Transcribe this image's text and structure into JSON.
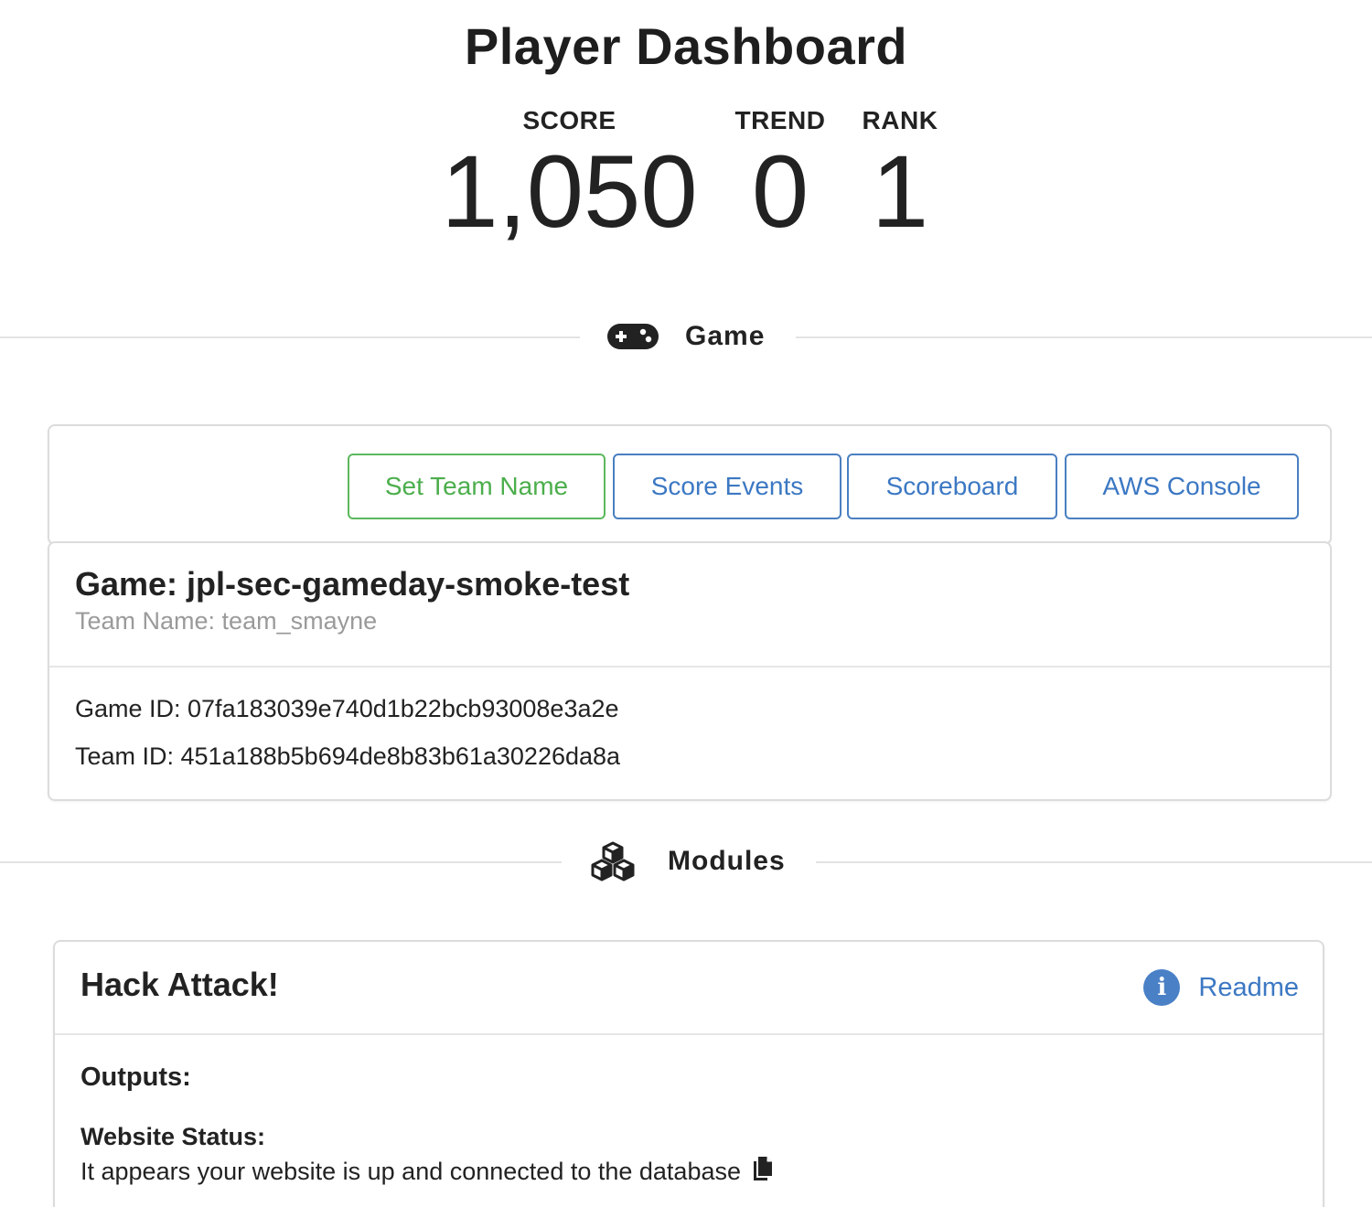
{
  "header": {
    "title": "Player Dashboard",
    "stats": {
      "score": {
        "label": "SCORE",
        "value": "1,050"
      },
      "trend": {
        "label": "TREND",
        "value": "0"
      },
      "rank": {
        "label": "RANK",
        "value": "1"
      }
    }
  },
  "sections": {
    "game": {
      "heading": "Game",
      "icon": "gamepad-icon"
    },
    "modules": {
      "heading": "Modules",
      "icon": "cubes-icon"
    }
  },
  "toolbar": {
    "set_team_name": "Set Team Name",
    "score_events": "Score Events",
    "scoreboard": "Scoreboard",
    "aws_console": "AWS Console"
  },
  "game": {
    "title": "Game: jpl-sec-gameday-smoke-test",
    "team_name": "Team Name: team_smayne",
    "game_id": "Game ID: 07fa183039e740d1b22bcb93008e3a2e",
    "team_id": "Team ID: 451a188b5b694de8b83b61a30226da8a"
  },
  "module": {
    "title": "Hack Attack!",
    "readme_label": "Readme",
    "readme_icon": "info-icon",
    "outputs_label": "Outputs:",
    "status_label": "Website Status:",
    "status_text": "It appears your website is up and connected to the database",
    "copy_icon": "copy-icon"
  },
  "colors": {
    "primary": "#3c78c3",
    "success": "#4cae4c",
    "muted": "#9a9a9a"
  }
}
